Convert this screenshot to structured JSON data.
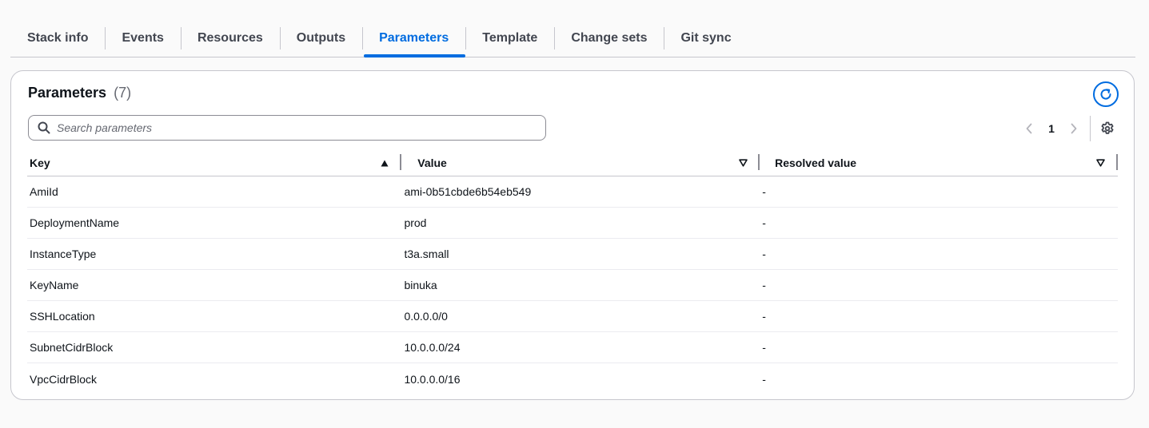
{
  "tabs": [
    {
      "label": "Stack info",
      "active": false
    },
    {
      "label": "Events",
      "active": false
    },
    {
      "label": "Resources",
      "active": false
    },
    {
      "label": "Outputs",
      "active": false
    },
    {
      "label": "Parameters",
      "active": true
    },
    {
      "label": "Template",
      "active": false
    },
    {
      "label": "Change sets",
      "active": false
    },
    {
      "label": "Git sync",
      "active": false
    }
  ],
  "panel": {
    "title": "Parameters",
    "count": "(7)",
    "refresh_icon": "refresh-icon"
  },
  "search": {
    "placeholder": "Search parameters",
    "value": ""
  },
  "pagination": {
    "current_page": "1",
    "prev_icon": "chevron-left-icon",
    "next_icon": "chevron-right-icon",
    "settings_icon": "gear-icon"
  },
  "table": {
    "columns": [
      {
        "label": "Key",
        "sort": "ascending"
      },
      {
        "label": "Value",
        "sort": "none"
      },
      {
        "label": "Resolved value",
        "sort": "none"
      }
    ],
    "rows": [
      {
        "key": "AmiId",
        "value": "ami-0b51cbde6b54eb549",
        "resolved": "-"
      },
      {
        "key": "DeploymentName",
        "value": "prod",
        "resolved": "-"
      },
      {
        "key": "InstanceType",
        "value": "t3a.small",
        "resolved": "-"
      },
      {
        "key": "KeyName",
        "value": "binuka",
        "resolved": "-"
      },
      {
        "key": "SSHLocation",
        "value": "0.0.0.0/0",
        "resolved": "-"
      },
      {
        "key": "SubnetCidrBlock",
        "value": "10.0.0.0/24",
        "resolved": "-"
      },
      {
        "key": "VpcCidrBlock",
        "value": "10.0.0.0/16",
        "resolved": "-"
      }
    ]
  },
  "colors": {
    "accent": "#006ce0",
    "text": "#0f141a",
    "muted": "#656871",
    "border": "#c6c6cd"
  }
}
